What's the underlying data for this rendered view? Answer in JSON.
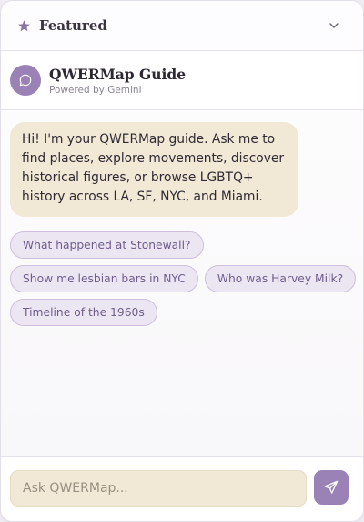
{
  "featured": {
    "label": "Featured",
    "icon": "star-icon",
    "toggle_icon": "chevron-down-icon"
  },
  "guide": {
    "title": "QWERMap Guide",
    "subtitle": "Powered by Gemini",
    "avatar_icon": "chat-bubble-icon"
  },
  "messages": [
    {
      "role": "assistant",
      "text": "Hi! I'm your QWERMap guide. Ask me to find places, explore movements, discover historical figures, or browse LGBTQ+ history across LA, SF, NYC, and Miami."
    }
  ],
  "suggestions": [
    "What happened at Stonewall?",
    "Show me lesbian bars in NYC",
    "Who was Harvey Milk?",
    "Timeline of the 1960s"
  ],
  "composer": {
    "placeholder": "Ask QWERMap...",
    "value": "",
    "send_icon": "send-icon"
  },
  "colors": {
    "accent": "#9a82b6",
    "bubble": "#f1e9d6",
    "chip_bg": "#ece6f3",
    "chip_text": "#6f5c8a"
  }
}
